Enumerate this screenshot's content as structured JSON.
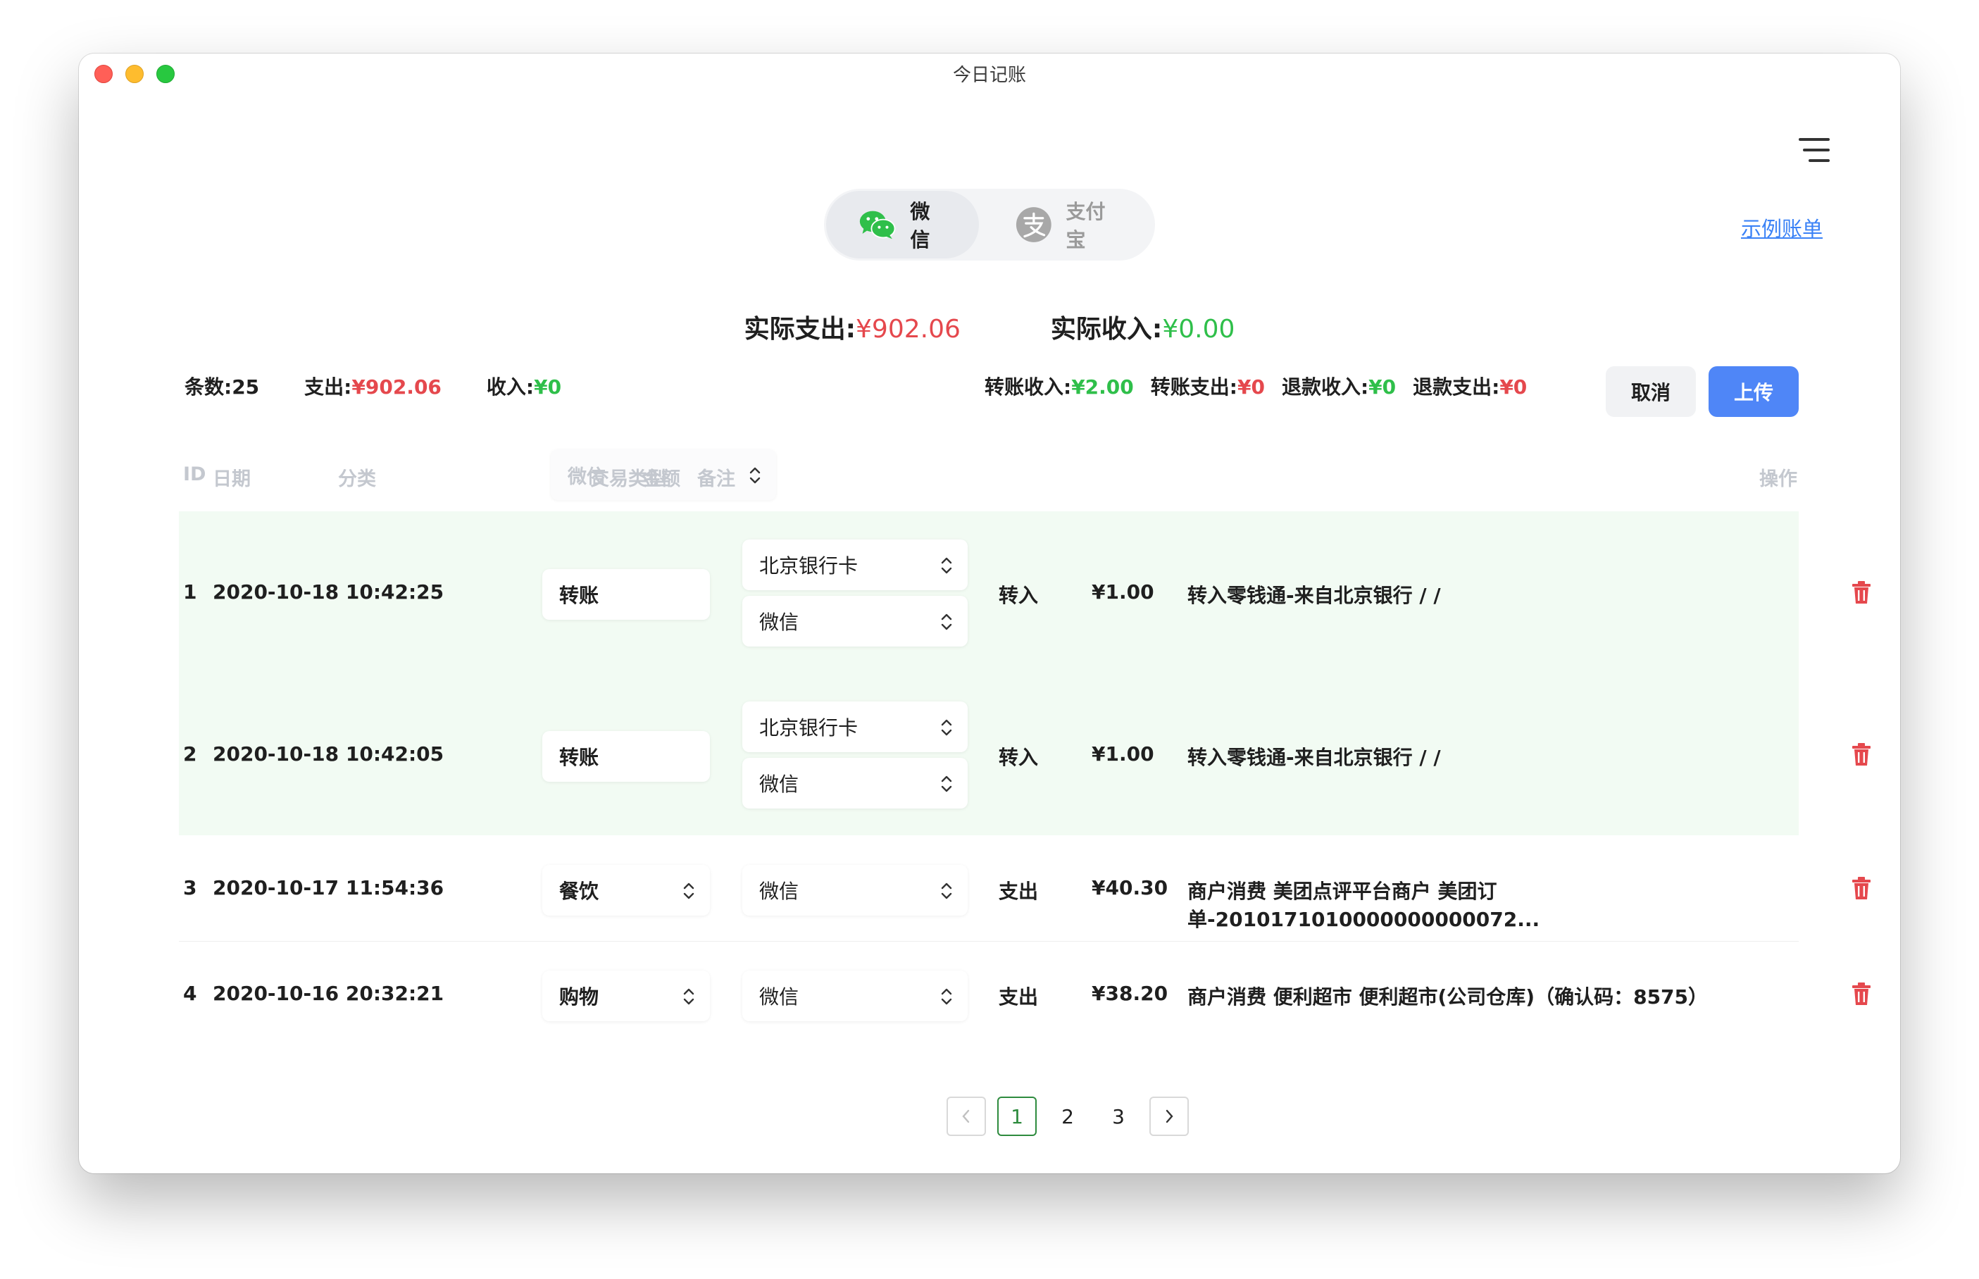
{
  "window": {
    "title": "今日记账"
  },
  "tabs": [
    {
      "label": "微信",
      "icon": "wechat-icon",
      "active": true
    },
    {
      "label": "支付宝",
      "icon": "alipay-icon",
      "active": false
    }
  ],
  "example_link": "示例账单",
  "actual": {
    "expense_label": "实际支出:",
    "expense_value": "¥902.06",
    "income_label": "实际收入:",
    "income_value": "¥0.00"
  },
  "stats": {
    "count_label": "条数:25",
    "expense_label": "支出:",
    "expense_value": "¥902.06",
    "income_label": "收入:",
    "income_value": "¥0",
    "transfer_in_label": "转账收入:",
    "transfer_in_value": "¥2.00",
    "transfer_out_label": "转账支出:",
    "transfer_out_value": "¥0",
    "refund_in_label": "退款收入:",
    "refund_in_value": "¥0",
    "refund_out_label": "退款支出:",
    "refund_out_value": "¥0"
  },
  "buttons": {
    "cancel": "取消",
    "upload": "上传"
  },
  "table": {
    "headers": {
      "id": "ID",
      "date": "日期",
      "category": "分类",
      "account_select": "微信",
      "type": "交易类型",
      "amount": "金额",
      "note": "备注",
      "action": "操作"
    },
    "rows": [
      {
        "id": "1",
        "date": "2020-10-18 10:42:25",
        "category": "转账",
        "account_from": "北京银行卡",
        "account_to": "微信",
        "type": "转入",
        "amount": "¥1.00",
        "note": "转入零钱通-来自北京银行 / /"
      },
      {
        "id": "2",
        "date": "2020-10-18 10:42:05",
        "category": "转账",
        "account_from": "北京银行卡",
        "account_to": "微信",
        "type": "转入",
        "amount": "¥1.00",
        "note": "转入零钱通-来自北京银行 / /"
      },
      {
        "id": "3",
        "date": "2020-10-17 11:54:36",
        "category": "餐饮",
        "account": "微信",
        "type": "支出",
        "amount": "¥40.30",
        "note": "商户消费 美团点评平台商户 美团订单-2010171010000000000072..."
      },
      {
        "id": "4",
        "date": "2020-10-16 20:32:21",
        "category": "购物",
        "account": "微信",
        "type": "支出",
        "amount": "¥38.20",
        "note": "商户消费 便利超市 便利超市(公司仓库)（确认码：8575）"
      }
    ]
  },
  "pagination": {
    "pages": [
      "1",
      "2",
      "3"
    ],
    "current": "1"
  },
  "colors": {
    "expense": "#e5484d",
    "income": "#2fbf4a",
    "primary": "#4f86f7",
    "transfer_row_bg": "#f2fbf3"
  }
}
